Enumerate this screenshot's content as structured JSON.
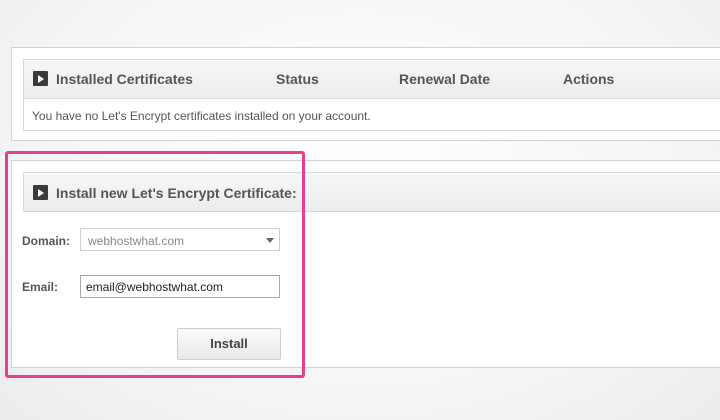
{
  "certificates_panel": {
    "columns": {
      "installed": "Installed Certificates",
      "status": "Status",
      "renewal_date": "Renewal Date",
      "actions": "Actions"
    },
    "empty_message": "You have no Let's Encrypt certificates installed on your account."
  },
  "install_panel": {
    "title": "Install new Let's Encrypt Certificate:",
    "domain_label": "Domain:",
    "domain_value": "webhostwhat.com",
    "email_label": "Email:",
    "email_value": "email@webhostwhat.com",
    "install_label": "Install"
  },
  "colors": {
    "highlight": "#e83e8c",
    "header_bg": "#efefef",
    "icon_dark": "#3a3a3a"
  },
  "icons": {
    "header_toggle": "triangle-right-icon",
    "select_arrow": "chevron-down-icon"
  }
}
